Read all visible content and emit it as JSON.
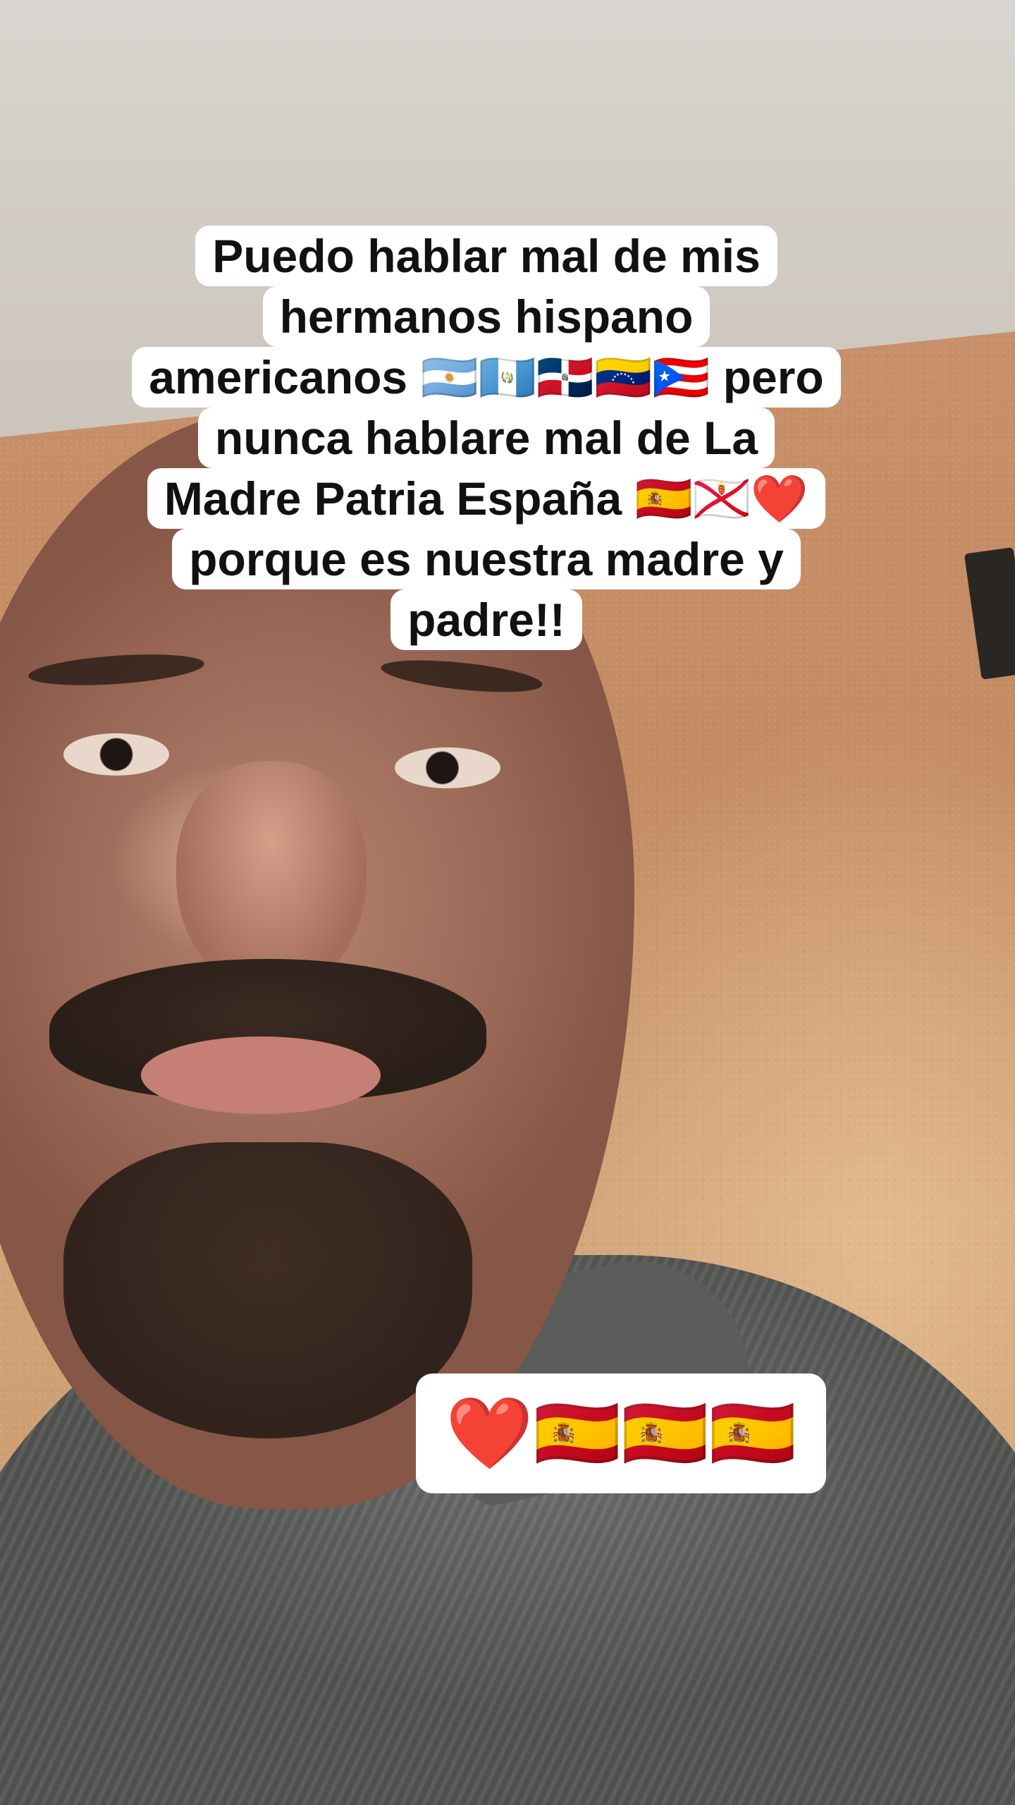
{
  "caption": {
    "lines": [
      "Puedo hablar mal de mis",
      "hermanos hispano",
      "americanos 🇦🇷🇬🇹🇩🇴🇻🇪🇵🇷 pero",
      "nunca hablare mal de La",
      "Madre Patria España 🇪🇸🇯🇪❤️",
      "porque es nuestra madre y",
      "padre!!"
    ]
  },
  "sticker": {
    "text": "❤️🇪🇸🇪🇸🇪🇸"
  }
}
